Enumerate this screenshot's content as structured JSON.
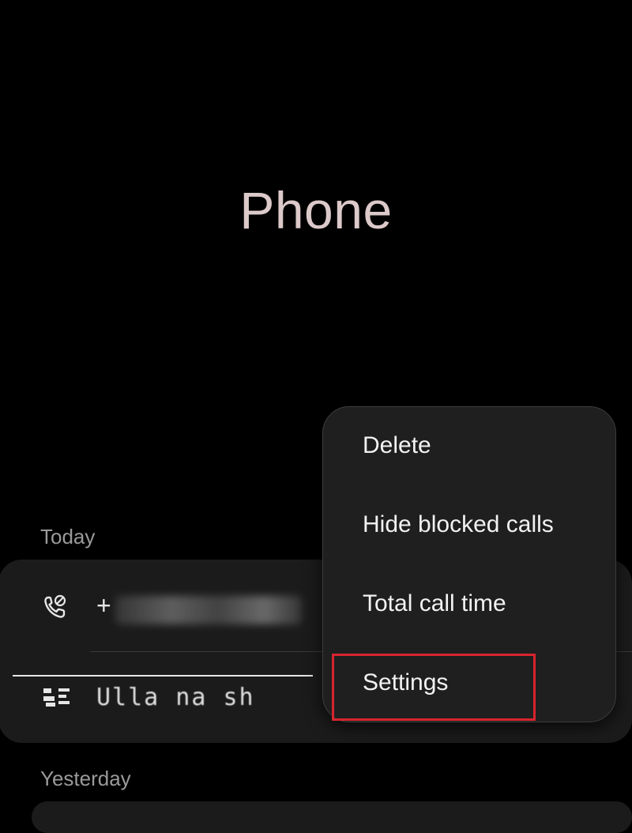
{
  "app": {
    "title": "Phone"
  },
  "call_log": {
    "sections": [
      {
        "header": "Today",
        "entries": [
          {
            "type": "blocked-call",
            "icon": "blocked-call-icon",
            "display": "+",
            "redacted": true
          },
          {
            "type": "contact",
            "icon": "contact-card-icon",
            "display": "Ulla na sh",
            "redacted": true
          }
        ]
      },
      {
        "header": "Yesterday",
        "entries": []
      }
    ]
  },
  "overflow_menu": {
    "items": [
      {
        "label": "Delete"
      },
      {
        "label": "Hide blocked calls"
      },
      {
        "label": "Total call time"
      },
      {
        "label": "Settings"
      }
    ],
    "highlighted_item": "Settings",
    "highlight_color": "#d7252f"
  },
  "colors": {
    "background": "#000000",
    "title": "#dcc9c9",
    "card": "#1b1b1b",
    "menu": "#1f1f1f",
    "section_header": "#9a9a9a"
  }
}
